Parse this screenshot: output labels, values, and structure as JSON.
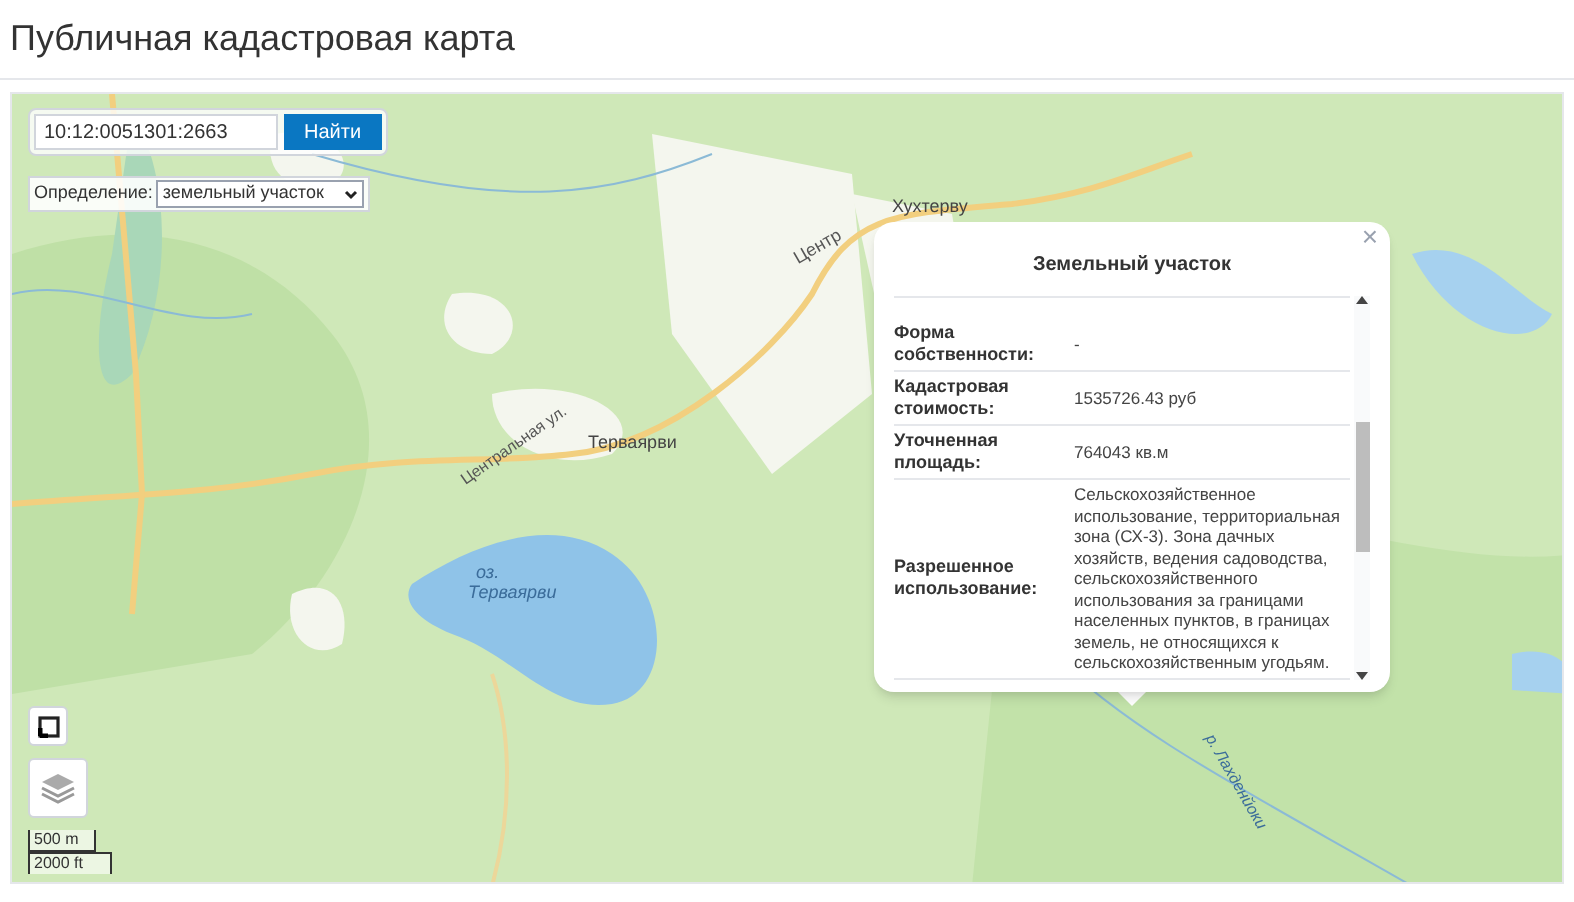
{
  "page_title": "Публичная кадастровая карта",
  "search": {
    "value": "10:12:0051301:2663",
    "button": "Найти"
  },
  "definition": {
    "label": "Определение:",
    "value": "земельный участок"
  },
  "map_labels": [
    {
      "kind": "place",
      "text": "Хухтерву"
    },
    {
      "kind": "street",
      "text": "Центр"
    },
    {
      "kind": "street",
      "text": "Центральная ул."
    },
    {
      "kind": "place",
      "text": "Терваярви"
    },
    {
      "kind": "water",
      "text": "оз."
    },
    {
      "kind": "water",
      "text": "Терваярви"
    },
    {
      "kind": "river",
      "text": "р. Лахденйоки"
    }
  ],
  "popup": {
    "title": "Земельный участок",
    "close": "×",
    "rows": [
      {
        "label": "Форма собственности:",
        "value": "-"
      },
      {
        "label": "Кадастровая стоимость:",
        "value": "1535726.43 руб"
      },
      {
        "label": "Уточненная площадь:",
        "value": "764043 кв.м"
      },
      {
        "label": "Разрешенное использование:",
        "value": "Сельскохозяйственное использование, территориальная зона (СХ-3). Зона дачных хозяйств, ведения садоводства, сельскохозяйственного использования за границами населенных пунктов, в границах земель, не относящихся к сельскохозяйственным угодьям."
      }
    ]
  },
  "scale": {
    "metric": "500 m",
    "imperial": "2000 ft"
  }
}
